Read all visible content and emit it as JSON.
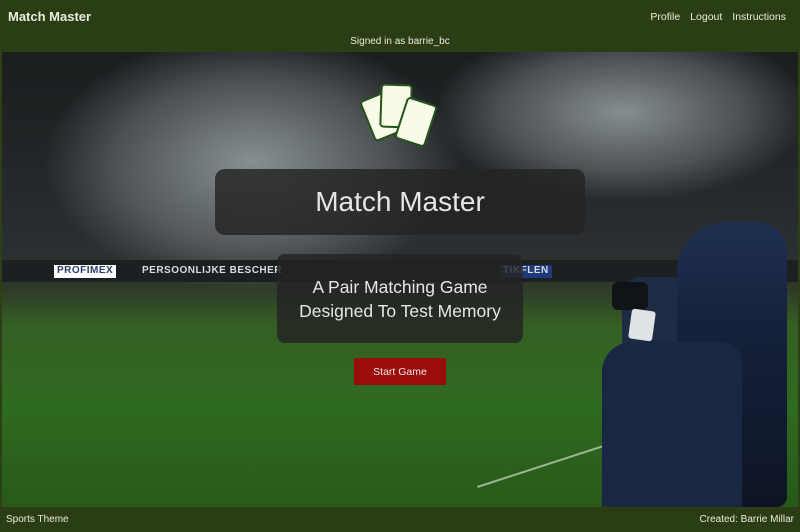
{
  "header": {
    "brand": "Match Master",
    "nav": [
      "Profile",
      "Logout",
      "Instructions"
    ],
    "signed_in": "Signed in as barrie_bc"
  },
  "hero": {
    "title": "Match Master",
    "subtitle": "A Pair Matching Game Designed To Test Memory",
    "start_button": "Start Game",
    "background_ads": [
      "PROFIMEX",
      "PERSOONLIJKE BESCHER",
      "TIKFLEN"
    ]
  },
  "footer": {
    "theme": "Sports Theme",
    "credit": "Created: Barrie Millar"
  },
  "colors": {
    "bar": "#2b3d14",
    "button": "#9b0d0d",
    "card": "#f8fbe6",
    "card_border": "#25521a"
  },
  "icons": {
    "logo": "cards-icon"
  }
}
